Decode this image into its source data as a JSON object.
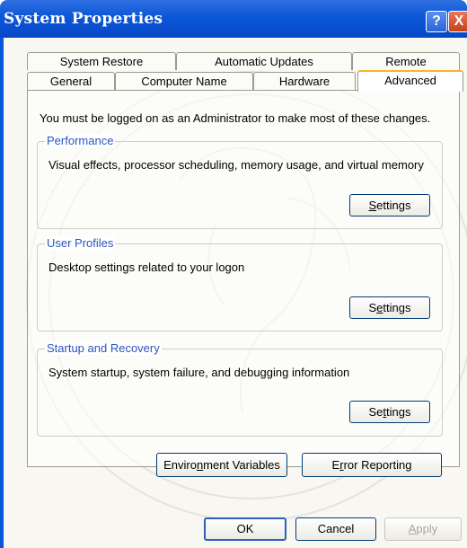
{
  "window": {
    "title": "System Properties",
    "help_label": "?",
    "close_label": "X"
  },
  "tabs": {
    "row1": [
      "System Restore",
      "Automatic Updates",
      "Remote"
    ],
    "row2": [
      "General",
      "Computer Name",
      "Hardware",
      "Advanced"
    ],
    "active": "Advanced"
  },
  "panel": {
    "intro": "You must be logged on as an Administrator to make most of these changes.",
    "groups": [
      {
        "title": "Performance",
        "description": "Visual effects, processor scheduling, memory usage, and virtual memory",
        "button": "Settings"
      },
      {
        "title": "User Profiles",
        "description": "Desktop settings related to your logon",
        "button": "Settings"
      },
      {
        "title": "Startup and Recovery",
        "description": "System startup, system failure, and debugging information",
        "button": "Settings"
      }
    ],
    "env_button": "Environment Variables",
    "error_button": "Error Reporting"
  },
  "footer": {
    "ok": "OK",
    "cancel": "Cancel",
    "apply": "Apply"
  }
}
